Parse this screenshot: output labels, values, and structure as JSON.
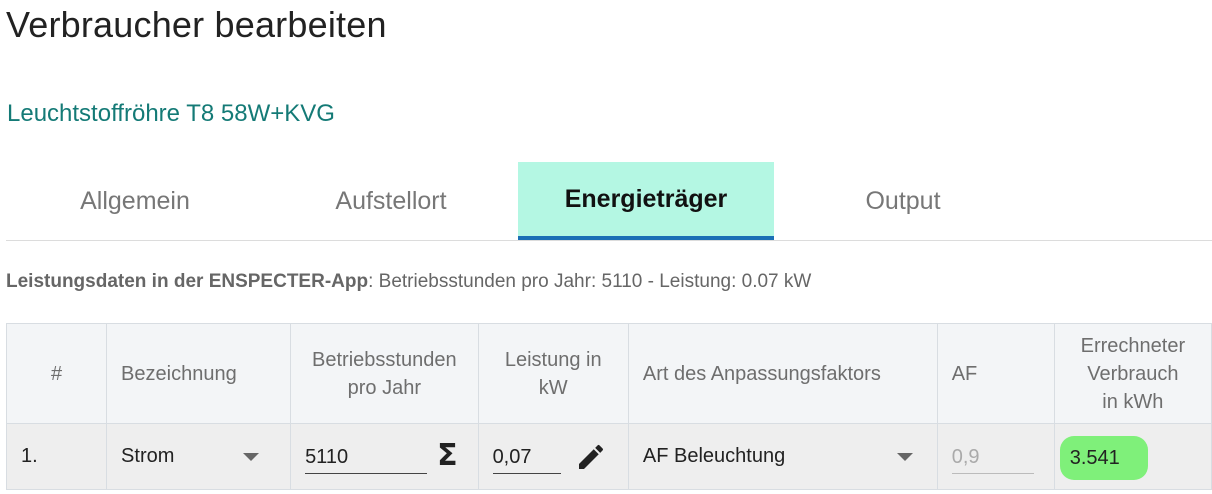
{
  "page": {
    "title": "Verbraucher bearbeiten",
    "subtitle": "Leuchtstoffröhre T8 58W+KVG"
  },
  "tabs": [
    {
      "label": "Allgemein",
      "active": false
    },
    {
      "label": "Aufstellort",
      "active": false
    },
    {
      "label": "Energieträger",
      "active": true
    },
    {
      "label": "Output",
      "active": false
    }
  ],
  "info": {
    "label": "Leistungsdaten in der ENSPECTER-App",
    "text": ": Betriebsstunden pro Jahr: 5110 - Leistung: 0.07 kW"
  },
  "table": {
    "headers": {
      "num": "#",
      "bezeichnung": "Bezeichnung",
      "betriebsstunden_1": "Betriebsstunden",
      "betriebsstunden_2": "pro Jahr",
      "leistung_1": "Leistung in",
      "leistung_2": "kW",
      "art": "Art des Anpassungsfaktors",
      "af": "AF",
      "verbrauch_1": "Errechneter",
      "verbrauch_2": "Verbrauch",
      "verbrauch_3": "in kWh"
    },
    "rows": [
      {
        "num": "1.",
        "bezeichnung": "Strom",
        "betriebsstunden": "5110",
        "leistung": "0,07",
        "art": "AF Beleuchtung",
        "af": "0,9",
        "verbrauch": "3.541"
      }
    ]
  },
  "icons": {
    "sum": "sigma-icon",
    "edit": "pencil-icon",
    "dropdown": "caret-down-icon"
  },
  "colors": {
    "active_tab_bg": "#b4f7e3",
    "active_tab_underline": "#1a6fb5",
    "subtitle": "#147a76",
    "result_badge": "#7ff07a"
  }
}
